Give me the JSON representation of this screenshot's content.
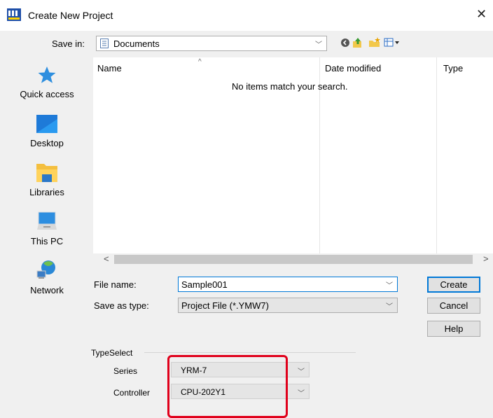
{
  "dialog": {
    "title": "Create New Project",
    "close_label": "✕"
  },
  "save_in": {
    "label": "Save in:",
    "value": "Documents"
  },
  "places": [
    {
      "label": "Quick access",
      "icon": "star-icon"
    },
    {
      "label": "Desktop",
      "icon": "desktop-icon"
    },
    {
      "label": "Libraries",
      "icon": "folder-icon"
    },
    {
      "label": "This PC",
      "icon": "computer-icon"
    },
    {
      "label": "Network",
      "icon": "network-icon"
    }
  ],
  "list": {
    "columns": [
      "Name",
      "Date modified",
      "Type"
    ],
    "empty_message": "No items match your search."
  },
  "scroll": {
    "left_arrow": "<",
    "right_arrow": ">"
  },
  "file_name": {
    "label": "File name:",
    "value": "Sample001"
  },
  "save_as_type": {
    "label": "Save as type:",
    "value": "Project File (*.YMW7)"
  },
  "buttons": {
    "create": "Create",
    "cancel": "Cancel",
    "help": "Help"
  },
  "type_select": {
    "group_label": "TypeSelect",
    "series_label": "Series",
    "series_value": "YRM-7",
    "controller_label": "Controller",
    "controller_value": "CPU-202Y1"
  },
  "colors": {
    "accent": "#0078d7",
    "highlight": "#e0001b",
    "window_bg": "#f0f0f0"
  }
}
